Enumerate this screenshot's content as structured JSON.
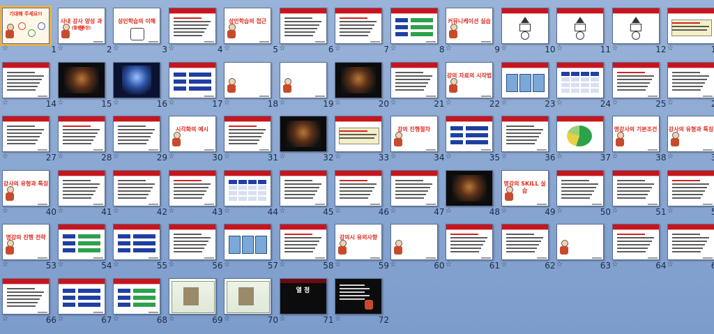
{
  "slide_sorter": {
    "slides": [
      {
        "number": "1",
        "title": "기대해 주세요!!",
        "layout": "welcome",
        "selected": true
      },
      {
        "number": "2",
        "title": "사내 강사 양성 과정",
        "subtitle": "(활동과정)",
        "layout": "title-cartoon"
      },
      {
        "number": "3",
        "title": "성인학습의 이해",
        "layout": "title-figure"
      },
      {
        "number": "4",
        "title": "",
        "layout": "text"
      },
      {
        "number": "5",
        "title": "성인학습의 접근",
        "layout": "title-cartoon"
      },
      {
        "number": "6",
        "title": "",
        "layout": "text"
      },
      {
        "number": "7",
        "title": "",
        "layout": "text"
      },
      {
        "number": "8",
        "title": "",
        "layout": "blue-boxes"
      },
      {
        "number": "9",
        "title": "커뮤니케이션 실습",
        "layout": "title-cartoon"
      },
      {
        "number": "10",
        "title": "",
        "layout": "shape-diagram"
      },
      {
        "number": "11",
        "title": "",
        "layout": "shape-diagram"
      },
      {
        "number": "12",
        "title": "",
        "layout": "shape-diagram"
      },
      {
        "number": "13",
        "title": "",
        "layout": "highlight-text"
      },
      {
        "number": "14",
        "title": "",
        "layout": "text"
      },
      {
        "number": "15",
        "title": "",
        "layout": "photo-dark"
      },
      {
        "number": "16",
        "title": "",
        "layout": "photo-blue"
      },
      {
        "number": "17",
        "title": "",
        "layout": "blue-boxes"
      },
      {
        "number": "18",
        "title": "",
        "layout": "title-cartoon"
      },
      {
        "number": "19",
        "title": "",
        "layout": "title-cartoon"
      },
      {
        "number": "20",
        "title": "",
        "layout": "photo-dark"
      },
      {
        "number": "21",
        "title": "",
        "layout": "text"
      },
      {
        "number": "22",
        "title": "강의 자료의 시작법",
        "layout": "title-cartoon"
      },
      {
        "number": "23",
        "title": "",
        "layout": "diagram"
      },
      {
        "number": "24",
        "title": "",
        "layout": "table"
      },
      {
        "number": "25",
        "title": "",
        "layout": "text"
      },
      {
        "number": "26",
        "title": "",
        "layout": "text"
      },
      {
        "number": "27",
        "title": "",
        "layout": "text"
      },
      {
        "number": "28",
        "title": "",
        "layout": "text"
      },
      {
        "number": "29",
        "title": "",
        "layout": "text"
      },
      {
        "number": "30",
        "title": "시각화의 예시",
        "layout": "title-cartoon"
      },
      {
        "number": "31",
        "title": "",
        "layout": "text"
      },
      {
        "number": "32",
        "title": "",
        "layout": "photo-dark"
      },
      {
        "number": "33",
        "title": "",
        "layout": "highlight-text"
      },
      {
        "number": "34",
        "title": "강의 진행절차",
        "layout": "title-cartoon"
      },
      {
        "number": "35",
        "title": "",
        "layout": "blue-boxes"
      },
      {
        "number": "36",
        "title": "",
        "layout": "text"
      },
      {
        "number": "37",
        "title": "",
        "layout": "pie"
      },
      {
        "number": "38",
        "title": "명강사의 기본조건",
        "layout": "title-cartoon"
      },
      {
        "number": "39",
        "title": "강사의 유형과 특징",
        "layout": "title-cartoon"
      },
      {
        "number": "40",
        "title": "강사의 유형과 특징",
        "layout": "title-cartoon"
      },
      {
        "number": "41",
        "title": "",
        "layout": "text"
      },
      {
        "number": "42",
        "title": "",
        "layout": "text"
      },
      {
        "number": "43",
        "title": "",
        "layout": "text"
      },
      {
        "number": "44",
        "title": "",
        "layout": "table"
      },
      {
        "number": "45",
        "title": "",
        "layout": "text"
      },
      {
        "number": "46",
        "title": "",
        "layout": "text"
      },
      {
        "number": "47",
        "title": "",
        "layout": "text"
      },
      {
        "number": "48",
        "title": "",
        "layout": "photo-dark"
      },
      {
        "number": "49",
        "title": "명강의 SKILL 실습",
        "layout": "title-cartoon"
      },
      {
        "number": "50",
        "title": "",
        "layout": "text"
      },
      {
        "number": "51",
        "title": "",
        "layout": "text"
      },
      {
        "number": "52",
        "title": "",
        "layout": "text"
      },
      {
        "number": "53",
        "title": "명강의 진행 전략",
        "layout": "title-cartoon"
      },
      {
        "number": "54",
        "title": "",
        "layout": "blue-boxes"
      },
      {
        "number": "55",
        "title": "",
        "layout": "blue-boxes"
      },
      {
        "number": "56",
        "title": "",
        "layout": "text"
      },
      {
        "number": "57",
        "title": "",
        "layout": "diagram"
      },
      {
        "number": "58",
        "title": "",
        "layout": "text"
      },
      {
        "number": "59",
        "title": "강의시 유의사항",
        "layout": "title-cartoon"
      },
      {
        "number": "60",
        "title": "",
        "layout": "title-cartoon"
      },
      {
        "number": "61",
        "title": "",
        "layout": "text"
      },
      {
        "number": "62",
        "title": "",
        "layout": "text"
      },
      {
        "number": "63",
        "title": "",
        "layout": "title-cartoon"
      },
      {
        "number": "64",
        "title": "",
        "layout": "text"
      },
      {
        "number": "65",
        "title": "",
        "layout": "text"
      },
      {
        "number": "66",
        "title": "",
        "layout": "text"
      },
      {
        "number": "67",
        "title": "",
        "layout": "blue-boxes"
      },
      {
        "number": "68",
        "title": "",
        "layout": "blue-boxes"
      },
      {
        "number": "69",
        "title": "",
        "layout": "screenshot"
      },
      {
        "number": "70",
        "title": "",
        "layout": "screenshot"
      },
      {
        "number": "71",
        "title": "열 정",
        "layout": "dark-title"
      },
      {
        "number": "72",
        "title": "",
        "layout": "dark-text"
      }
    ]
  },
  "colors": {
    "background_top": "#9ab3d8",
    "background_bottom": "#7c9ccc",
    "header_red": "#c8141c",
    "selection": "#e8b04a",
    "accent_blue": "#1f3fa2"
  },
  "icons": {
    "star": "transition-star-icon"
  }
}
